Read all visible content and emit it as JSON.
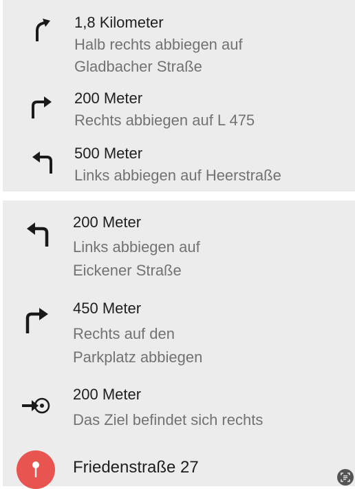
{
  "steps_panel_1": [
    {
      "distance": "1,8 Kilometer",
      "line1": "Halb rechts abbiegen auf",
      "line2": "Gladbacher Straße",
      "icon": "slight-right-arrow-icon"
    },
    {
      "distance": "200 Meter",
      "line1": "Rechts abbiegen auf L 475",
      "icon": "turn-right-arrow-icon"
    },
    {
      "distance": "500 Meter",
      "line1": "Links abbiegen auf Heerstraße",
      "icon": "turn-left-arrow-icon"
    }
  ],
  "steps_panel_2": [
    {
      "distance": "200 Meter",
      "line1": "Links abbiegen auf",
      "line2": "Eickener Straße",
      "icon": "turn-left-arrow-icon"
    },
    {
      "distance": "450 Meter",
      "line1": "Rechts auf den",
      "line2": "Parkplatz abbiegen",
      "icon": "turn-right-arrow-icon"
    },
    {
      "distance": "200 Meter",
      "line1": "Das Ziel befindet sich rechts",
      "icon": "destination-right-icon"
    }
  ],
  "destination": {
    "address": "Friedenstraße 27",
    "icon": "location-pin-icon",
    "color": "#e85450"
  },
  "colors": {
    "panel_background": "#ececec",
    "primary_text": "#1e1e1e",
    "secondary_text": "#727272"
  }
}
